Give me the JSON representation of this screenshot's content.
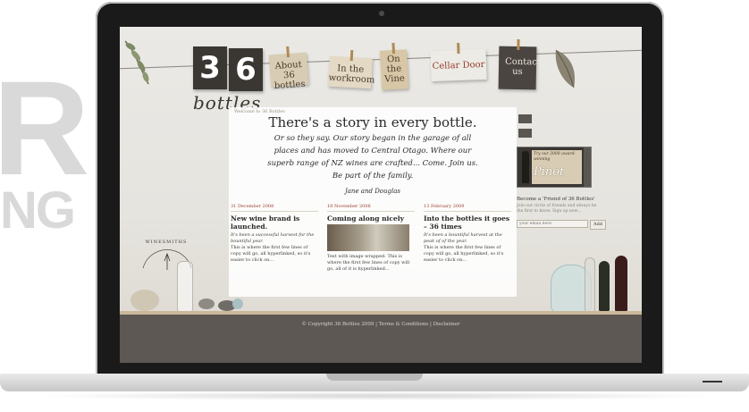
{
  "background_text": {
    "big": "R",
    "small": "NG"
  },
  "site": {
    "logo_digits": [
      "3",
      "6"
    ],
    "logo_word": "bottles",
    "nav": [
      {
        "label": "About 36 bottles"
      },
      {
        "label": "In the workroom"
      },
      {
        "label": "On the Vine"
      },
      {
        "label": "Cellar Door"
      },
      {
        "label": "Contact us"
      }
    ]
  },
  "main": {
    "welcome": "Welcome to 36 Bottles",
    "headline": "There's a story in every bottle.",
    "intro": "Or so they say. Our story began in the garage of all places and has moved to Central Otago. Where our superb range of NZ wines are crafted... Come. Join us. Be part of the family.",
    "signature": "Jane and Douglas"
  },
  "posts": [
    {
      "date": "31 December 2008",
      "title": "New wine brand is launched.",
      "lead": "It's been a successful harvest for the bountiful year.",
      "body": "This is where the first few lines of copy will go, all hyperlinked, so it's easier to click on..."
    },
    {
      "date": "18 November 2008",
      "title": "Coming along nicely",
      "body": "Text with image wrapped. This is where the first few lines of copy will go, all of it is hyperlinked..."
    },
    {
      "date": "13 February 2009",
      "title": "Into the bottles it goes – 36 times",
      "lead": "It's been a bountiful harvest at the peak of of the year.",
      "body": "This is where the first few lines of copy will go, all hyperlinked, so it's easier to click on..."
    }
  ],
  "sidebar": {
    "promo_text": "Try our 2008 award-winning",
    "promo_product": "Pinot",
    "friend_title": "Become a 'Friend of 36 Bottles'",
    "friend_text": "Join our circle of friends and always be the first to know. Sign up now...",
    "email_placeholder": "your email here",
    "add_label": "Add"
  },
  "decor": {
    "stamp_text": "WINESMITHS"
  },
  "footer": {
    "text": "© Copyright 36 Bottles 2009 | Terms & Conditions | Disclaimer"
  },
  "colors": {
    "accent": "#9a3a2a",
    "footer_bg": "#5d5853",
    "card_dark": "#3a3632"
  }
}
